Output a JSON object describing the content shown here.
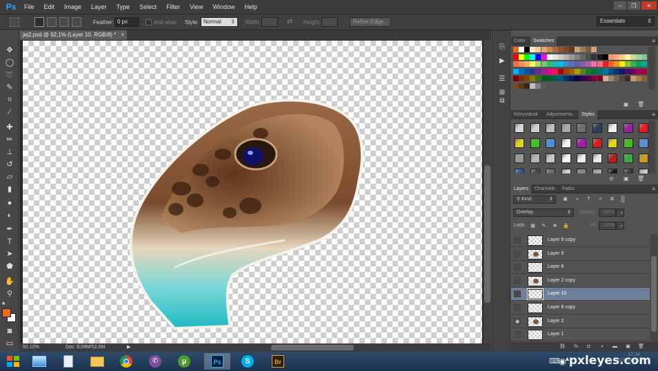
{
  "app": {
    "logo": "Ps"
  },
  "menubar": {
    "items": [
      "File",
      "Edit",
      "Image",
      "Layer",
      "Type",
      "Select",
      "Filter",
      "View",
      "Window",
      "Help"
    ]
  },
  "window_controls": {
    "minimize": "–",
    "restore": "❐",
    "close": "✕"
  },
  "options": {
    "feather_label": "Feather:",
    "feather_value": "0 px",
    "antialias_label": "Anti-alias",
    "style_label": "Style:",
    "style_value": "Normal",
    "width_label": "Width:",
    "height_label": "Height:",
    "refine_edge": "Refine Edge...",
    "workspace": "Essentials"
  },
  "tools": [
    "marquee-tool",
    "ellipse-marquee-tool",
    "lasso-tool",
    "quick-selection-tool",
    "crop-tool",
    "eyedropper-tool",
    "spot-healing-tool",
    "brush-tool",
    "clone-stamp-tool",
    "history-brush-tool",
    "eraser-tool",
    "gradient-tool",
    "blur-tool",
    "dodge-tool",
    "pen-tool",
    "type-tool",
    "path-selection-tool",
    "shape-tool",
    "hand-tool",
    "zoom-tool"
  ],
  "colors": {
    "foreground": "#ef6a18",
    "background": "#ffffff",
    "accent_selected": "#6d7f99"
  },
  "document": {
    "tab_title": "jej2.psd @ 92,1% (Layer 10, RGB/8) *",
    "close": "×",
    "zoom": "92,12%",
    "doc_info": "Doc: 6,59M/52,0M"
  },
  "swatches": {
    "tabs": [
      "Color",
      "Swatches"
    ],
    "active": 1
  },
  "styles": {
    "tabs": [
      "Könyvtárak",
      "Adjustments",
      "Styles"
    ],
    "active": 2
  },
  "layers_panel": {
    "tabs": [
      "Layers",
      "Channels",
      "Paths"
    ],
    "active": 0,
    "filter_kind": "Kind",
    "blend_mode": "Overlay",
    "opacity_label": "Opacity:",
    "opacity_value": "100%",
    "lock_label": "Lock:",
    "fill_label": "Fill:",
    "fill_value": "100%",
    "layers": [
      {
        "name": "Layer 6 copy",
        "visible": false,
        "selected": false,
        "content": false
      },
      {
        "name": "Layer 9",
        "visible": false,
        "selected": false,
        "content": true
      },
      {
        "name": "Layer 8",
        "visible": false,
        "selected": false,
        "content": false
      },
      {
        "name": "Layer 2 copy",
        "visible": false,
        "selected": false,
        "content": true
      },
      {
        "name": "Layer 10",
        "visible": false,
        "selected": true,
        "content": false
      },
      {
        "name": "Layer 8 copy",
        "visible": false,
        "selected": false,
        "content": false
      },
      {
        "name": "Layer 2",
        "visible": true,
        "selected": false,
        "content": true
      },
      {
        "name": "Layer 1",
        "visible": false,
        "selected": false,
        "content": false
      }
    ],
    "footer_icons": [
      "link-layers-icon",
      "fx-icon",
      "layer-mask-icon",
      "adjustment-layer-icon",
      "group-icon",
      "new-layer-icon",
      "trash-icon"
    ],
    "fx_label": "fx."
  },
  "taskbar": {
    "apps": [
      "file-explorer-icon",
      "calculator-icon",
      "folder-icon",
      "chrome-icon",
      "viber-icon",
      "utorrent-icon",
      "photoshop-icon",
      "skype-icon",
      "bridge-icon"
    ],
    "ps": "Ps",
    "br": "Br",
    "utorrent": "µ",
    "skype": "S",
    "watermark": "pxleyes.com",
    "time": "12:34",
    "date": "2016.02.07."
  }
}
